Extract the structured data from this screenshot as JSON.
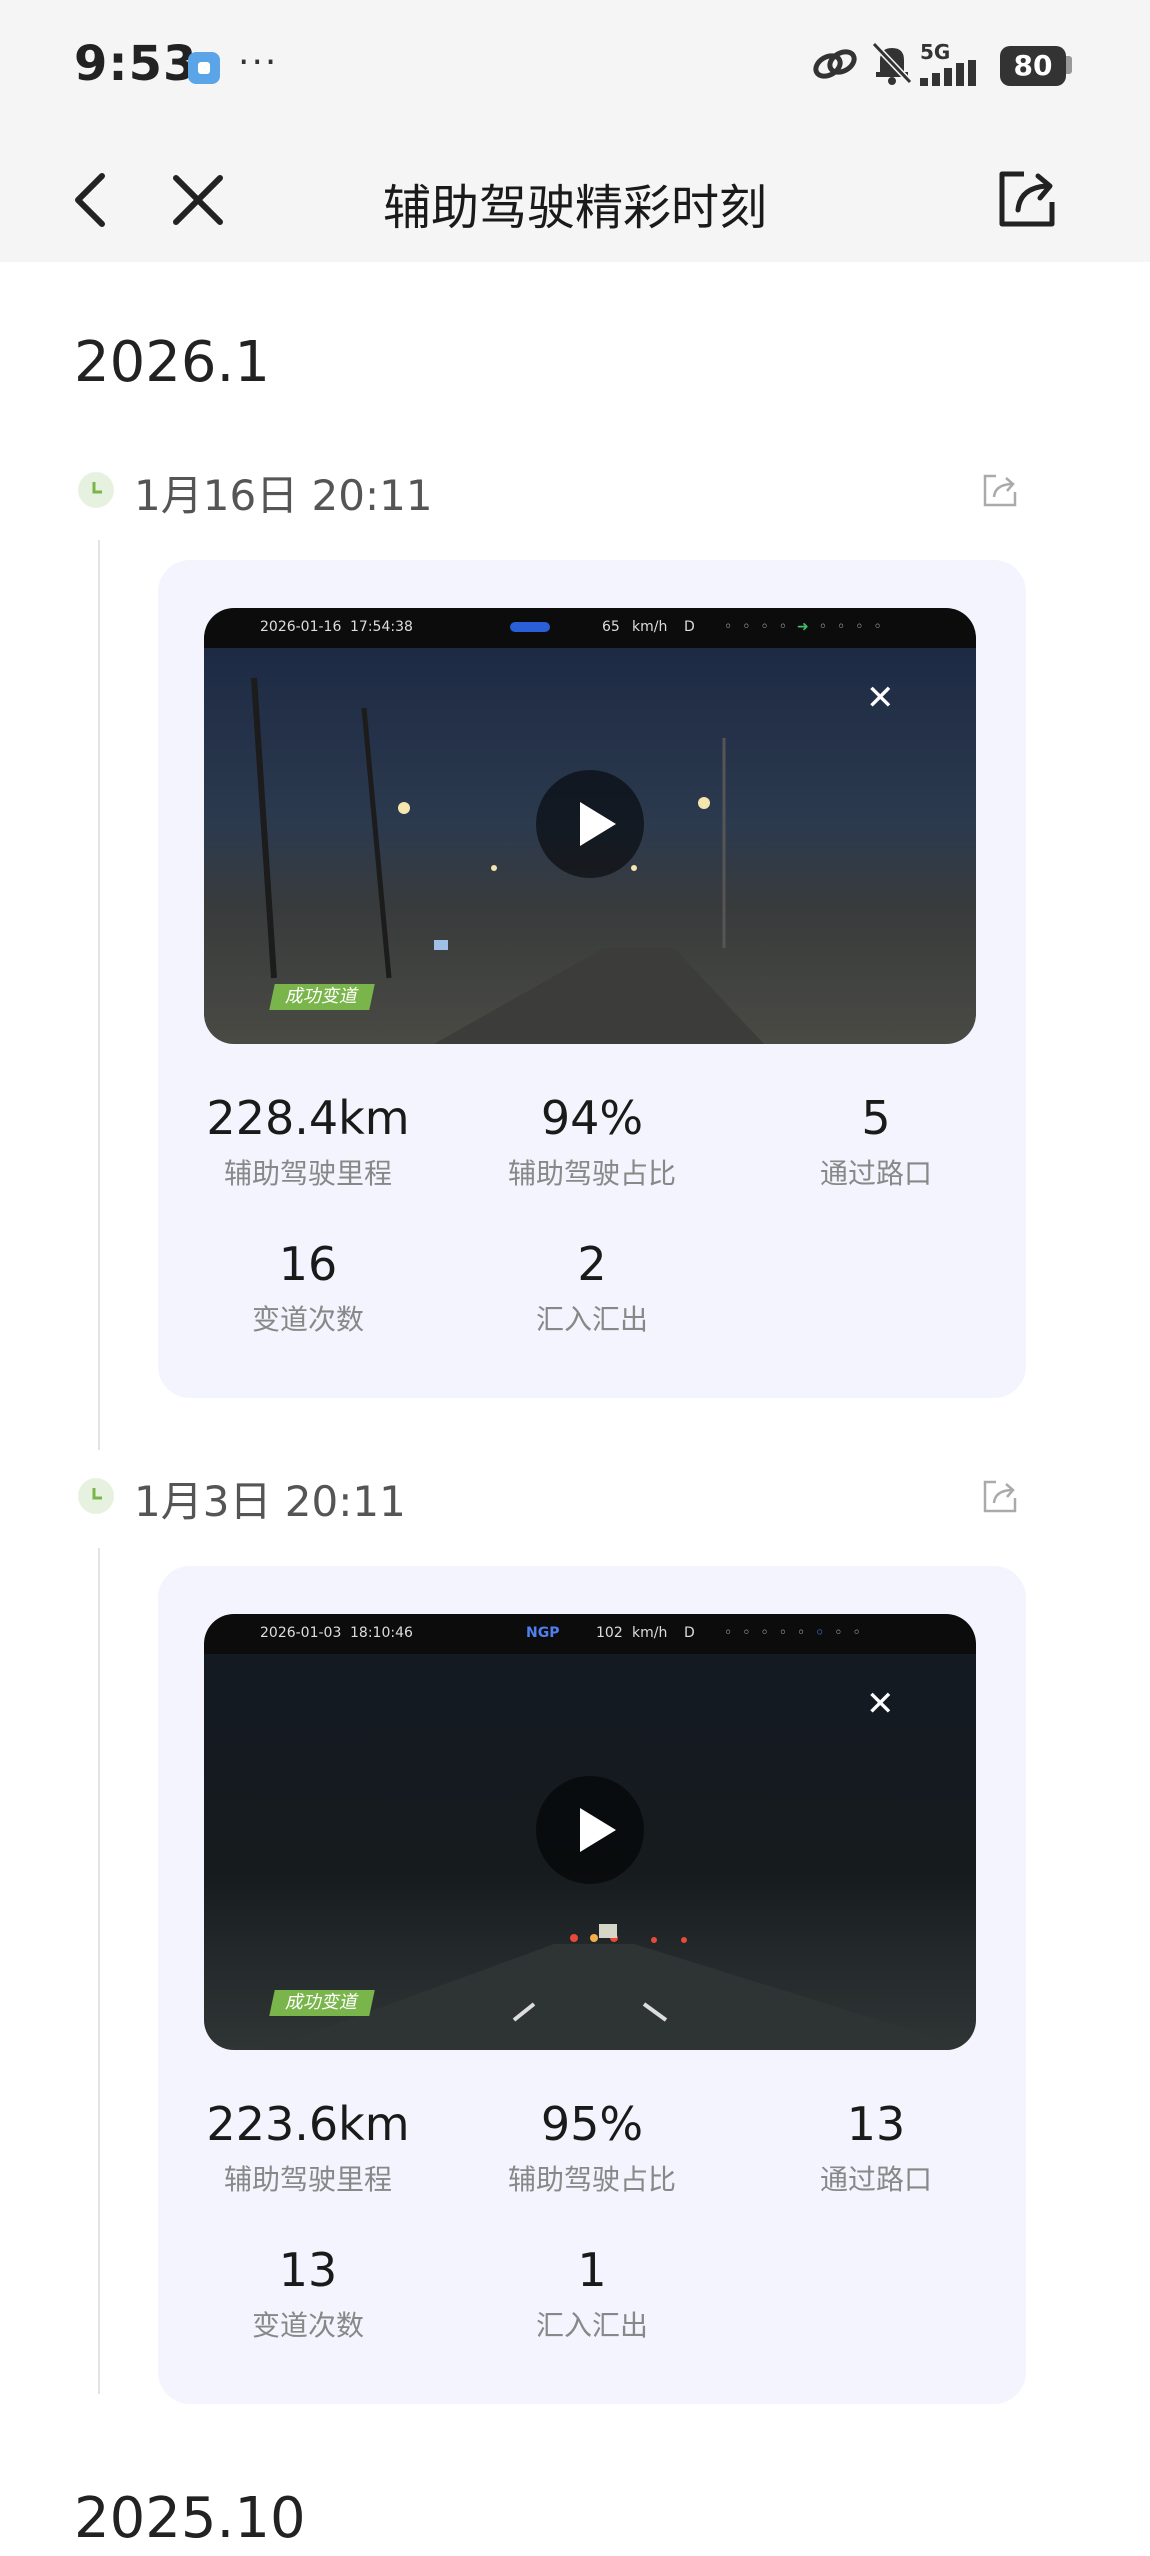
{
  "status_bar": {
    "time": "9:53",
    "dots": "···",
    "network": "5G",
    "battery": "80"
  },
  "nav": {
    "title": "辅助驾驶精彩时刻"
  },
  "sections": [
    {
      "title": "2026.1",
      "entries": [
        {
          "date": "1月16日 20:11",
          "video": {
            "hud_date": "2026-01-16",
            "hud_time": "17:54:38",
            "hud_speed": "65",
            "hud_unit": "km/h",
            "hud_gear": "D",
            "tag": "成功变道"
          },
          "stats": [
            {
              "value": "228.4km",
              "label": "辅助驾驶里程"
            },
            {
              "value": "94%",
              "label": "辅助驾驶占比"
            },
            {
              "value": "5",
              "label": "通过路口"
            },
            {
              "value": "16",
              "label": "变道次数"
            },
            {
              "value": "2",
              "label": "汇入汇出"
            }
          ]
        },
        {
          "date": "1月3日 20:11",
          "video": {
            "hud_date": "2026-01-03",
            "hud_time": "18:10:46",
            "hud_mode": "NGP",
            "hud_speed": "102",
            "hud_unit": "km/h",
            "hud_gear": "D",
            "tag": "成功变道"
          },
          "stats": [
            {
              "value": "223.6km",
              "label": "辅助驾驶里程"
            },
            {
              "value": "95%",
              "label": "辅助驾驶占比"
            },
            {
              "value": "13",
              "label": "通过路口"
            },
            {
              "value": "13",
              "label": "变道次数"
            },
            {
              "value": "1",
              "label": "汇入汇出"
            }
          ]
        }
      ]
    },
    {
      "title": "2025.10"
    }
  ]
}
